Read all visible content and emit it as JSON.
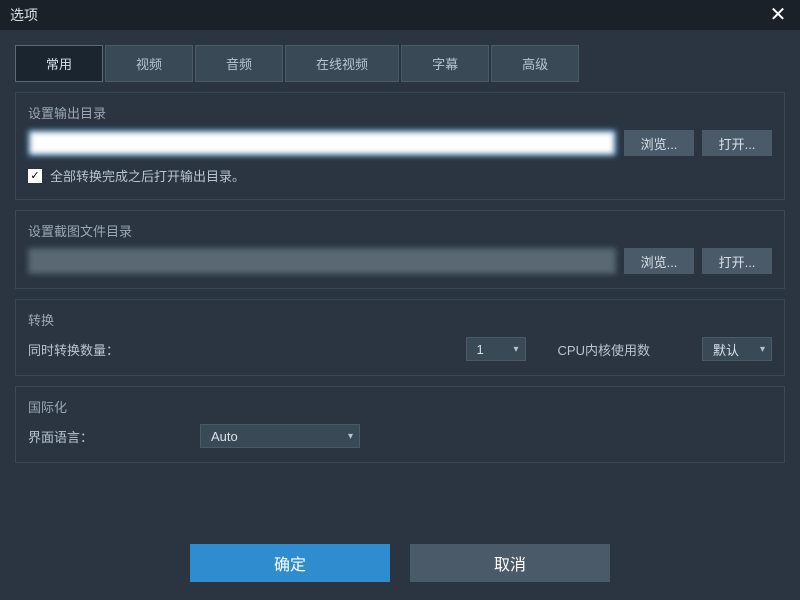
{
  "titlebar": {
    "title": "选项"
  },
  "tabs": [
    {
      "label": "常用",
      "active": true
    },
    {
      "label": "视频",
      "active": false
    },
    {
      "label": "音频",
      "active": false
    },
    {
      "label": "在线视频",
      "active": false
    },
    {
      "label": "字幕",
      "active": false
    },
    {
      "label": "高级",
      "active": false
    }
  ],
  "output_section": {
    "label": "设置输出目录",
    "path_value": "",
    "browse_label": "浏览...",
    "open_label": "打开...",
    "checkbox_checked": true,
    "checkbox_label": "全部转换完成之后打开输出目录。"
  },
  "snapshot_section": {
    "label": "设置截图文件目录",
    "path_value": "",
    "browse_label": "浏览...",
    "open_label": "打开..."
  },
  "convert_section": {
    "label": "转换",
    "concurrent_label": "同时转换数量：",
    "concurrent_value": "1",
    "cpu_label": "CPU内核使用数",
    "cpu_value": "默认"
  },
  "i18n_section": {
    "label": "国际化",
    "ui_lang_label": "界面语言：",
    "ui_lang_value": "Auto"
  },
  "footer": {
    "ok_label": "确定",
    "cancel_label": "取消"
  }
}
